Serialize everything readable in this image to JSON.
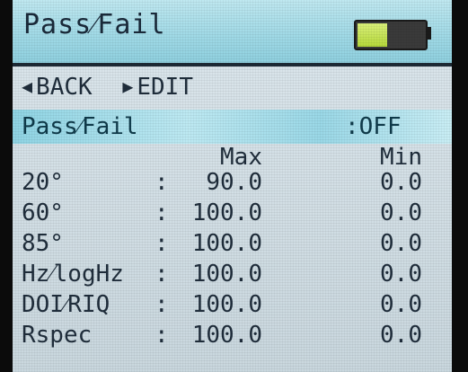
{
  "header": {
    "title": "Pass⁄Fail",
    "battery_level": 0.45,
    "battery_color": "#c4e24f"
  },
  "nav": {
    "back_label": "BACK",
    "edit_label": "EDIT",
    "back_icon": "triangle-left-icon",
    "edit_icon": "triangle-right-icon"
  },
  "setting": {
    "label": "Pass⁄Fail",
    "separator": ":",
    "value": "OFF",
    "highlight_color": "#9ad8e7"
  },
  "table": {
    "columns": [
      "Max",
      "Min"
    ],
    "rows": [
      {
        "name": "20°",
        "colon": ":",
        "max": "90.0",
        "min": "0.0"
      },
      {
        "name": "60°",
        "colon": ":",
        "max": "100.0",
        "min": "0.0"
      },
      {
        "name": "85°",
        "colon": ":",
        "max": "100.0",
        "min": "0.0"
      },
      {
        "name": "Hz⁄logHz",
        "colon": ":",
        "max": "100.0",
        "min": "0.0"
      },
      {
        "name": "DOI⁄RIQ",
        "colon": ":",
        "max": "100.0",
        "min": "0.0"
      },
      {
        "name": "Rspec",
        "colon": ":",
        "max": "100.0",
        "min": "0.0"
      }
    ]
  }
}
